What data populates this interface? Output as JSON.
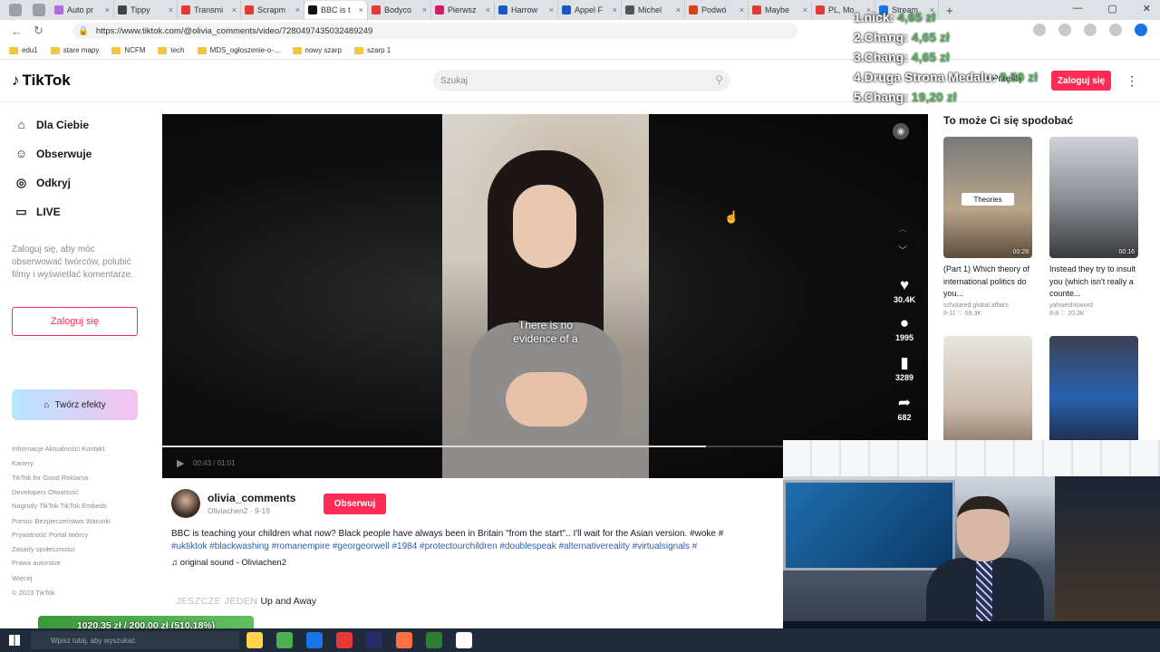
{
  "browser": {
    "tabs": [
      {
        "label": "Auto pr",
        "color": "#b36be0"
      },
      {
        "label": "Tippy",
        "color": "#444"
      },
      {
        "label": "Transmi",
        "color": "#e53935"
      },
      {
        "label": "Scrapm",
        "color": "#e53935"
      },
      {
        "label": "BBC is t",
        "color": "#111"
      },
      {
        "label": "Bodyco",
        "color": "#e53935"
      },
      {
        "label": "Pierwsz",
        "color": "#d81b60"
      },
      {
        "label": "Harrow",
        "color": "#1a56c4"
      },
      {
        "label": "Appel F",
        "color": "#1a56c4"
      },
      {
        "label": "Michel",
        "color": "#555"
      },
      {
        "label": "Podwó",
        "color": "#d84315"
      },
      {
        "label": "Maybe",
        "color": "#e53935"
      },
      {
        "label": "PL, Mo",
        "color": "#e53935"
      },
      {
        "label": "Stream",
        "color": "#1a73e8"
      }
    ],
    "new_tab": "+",
    "url": "https://www.tiktok.com/@olivia_comments/video/7280497435032489249",
    "bookmarks": [
      "edu1",
      "stare mapy",
      "NCFM",
      "tech",
      "MDS_ogłoszenie-o-...",
      "nowy szarp",
      "szarp 1"
    ]
  },
  "tiktok": {
    "logo": "TikTok",
    "search_placeholder": "Szukaj",
    "upload_label": "Prześlij",
    "login_label": "Zaloguj się",
    "nav": [
      {
        "label": "Dla Ciebie",
        "icon": "home-icon",
        "glyph": "⌂"
      },
      {
        "label": "Obserwuje",
        "icon": "people-icon",
        "glyph": "☺"
      },
      {
        "label": "Odkryj",
        "icon": "compass-icon",
        "glyph": "◎"
      },
      {
        "label": "LIVE",
        "icon": "live-icon",
        "glyph": "▭"
      }
    ],
    "login_prompt": "Zaloguj się, aby móc obserwować twórców, polubić filmy i wyświetlać komentarze.",
    "sidebar_login": "Zaloguj się",
    "effects_label": "Twórz efekty",
    "footer": [
      "Informacje  Aktualności  Kontakt",
      "Kariery",
      "",
      "TikTok for Good  Reklama",
      "Developers  Otwartość",
      "Nagrody TikTok  TikTok Embeds",
      "",
      "Pomoc  Bezpieczeństwo  Warunki",
      "Prywatność  Portal twórcy",
      "Zasady społeczności",
      "Prawa autorskie",
      "",
      "Więcej",
      "",
      "© 2023 TikTok"
    ],
    "video": {
      "caption_line1": "There is no",
      "caption_line2": "evidence of a",
      "time": "00:43 / 01:01",
      "progress": 0.71,
      "actions": [
        {
          "icon": "heart-icon",
          "glyph": "♥",
          "count": "30.4K"
        },
        {
          "icon": "comment-icon",
          "glyph": "●",
          "count": "1995"
        },
        {
          "icon": "bookmark-icon",
          "glyph": "▮",
          "count": "3289"
        },
        {
          "icon": "share-icon",
          "glyph": "➦",
          "count": "682"
        }
      ]
    },
    "author": {
      "username": "olivia_comments",
      "subline": "Oliviachen2 · 9-19",
      "follow_label": "Obserwuj"
    },
    "description": "BBC is teaching your children what now? Black people have always been in Britain \"from the start\".. I'll wait for the Asian version. #woke #",
    "hashtags": "#uktiktok #blackwashing #romanempire #georgeorwell #1984 #protectourchildren #doublespeak #alternativereality #virtualsignals #",
    "sound": "♫ original sound - Oliviachen2",
    "now_playing_overlay": "JESZCZE JEDEN",
    "now_playing": "Up and Away",
    "recommend_title": "To może Ci się spodobać",
    "recommendations": [
      {
        "caption": "(Part 1) Which theory of international politics do you...",
        "author": "scholared.global.affairs",
        "meta": "9-11  ♡ 59.3K",
        "duration": "00:28",
        "tag": "Theories",
        "bg": "linear-gradient(180deg,#7a7a7a,#b9a58a 60%,#5e4c3c)"
      },
      {
        "caption": "Instead they try to insult you (which isn't really a counte...",
        "author": "yahweshisword",
        "meta": "8-8  ♡ 20.3K",
        "duration": "00:16",
        "tag": "",
        "bg": "linear-gradient(180deg,#cfd2d6,#8d9096 50%,#3a3b3f)"
      },
      {
        "caption": "",
        "author": "",
        "meta": "",
        "duration": "",
        "tag": "",
        "bg": "linear-gradient(180deg,#e9e6e2,#c9b8a8 60%,#7a6657)"
      },
      {
        "caption": "",
        "author": "",
        "meta": "",
        "duration": "",
        "tag": "",
        "bg": "linear-gradient(180deg,#3c4254,#2a61b0 50%,#1b1f2b)"
      }
    ]
  },
  "stream_overlay": {
    "leaderboard": [
      {
        "name": "1.nick:",
        "amount": "4,65 zł"
      },
      {
        "name": "2.Chang:",
        "amount": "4,65 zł"
      },
      {
        "name": "3.Chang:",
        "amount": "4,65 zł"
      },
      {
        "name": "4.Druga Strona Medalu:",
        "amount": "9,50 zł"
      },
      {
        "name": "5.Chang:",
        "amount": "19,20 zł"
      }
    ],
    "donation_goal": "1020,35 zł / 200,00 zł (510.18%)"
  },
  "taskbar": {
    "search_placeholder": "Wpisz tutaj, aby wyszukać",
    "apps": [
      "#ffd24a",
      "#4caf50",
      "#1a73e8",
      "#e53935",
      "#2b2b6b",
      "#ff7043",
      "#2e7d32",
      "#ffffff"
    ]
  }
}
